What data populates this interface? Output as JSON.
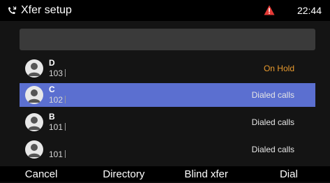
{
  "statusbar": {
    "title": "Xfer setup",
    "time": "22:44",
    "alert_color": "#e53935"
  },
  "search": {
    "value": "",
    "placeholder": ""
  },
  "calls": [
    {
      "name": "D",
      "number": "103",
      "status": "On Hold",
      "selected": false
    },
    {
      "name": "C",
      "number": "102",
      "status": "Dialed calls",
      "selected": true
    },
    {
      "name": "B",
      "number": "101",
      "status": "Dialed calls",
      "selected": false
    },
    {
      "name": "",
      "number": "101",
      "status": "Dialed calls",
      "selected": false
    }
  ],
  "softkeys": {
    "cancel": "Cancel",
    "directory": "Directory",
    "blind_xfer": "Blind xfer",
    "dial": "Dial"
  },
  "colors": {
    "selection": "#5b6fd0",
    "on_hold": "#e89a2e"
  }
}
